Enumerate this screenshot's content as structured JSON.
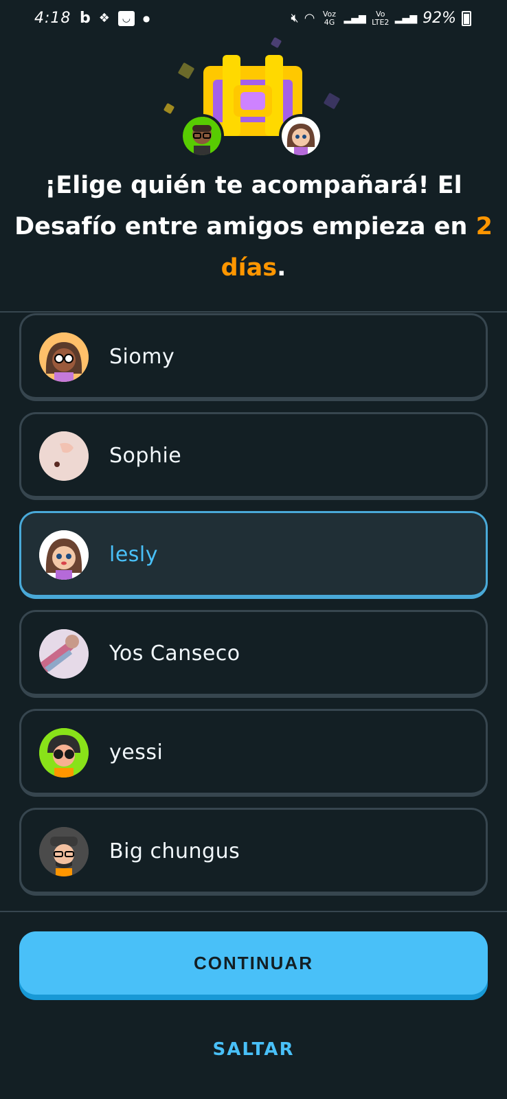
{
  "status_bar": {
    "time": "4:18",
    "battery": "92%",
    "network_labels": [
      "Voz 4G",
      "Vo LTE2"
    ]
  },
  "headline": {
    "text": "¡Elige quién te acompañará! El Desafío entre amigos empieza en ",
    "accent": "2 días",
    "suffix": "."
  },
  "friends": [
    {
      "name": "Siomy",
      "selected": false
    },
    {
      "name": "Sophie",
      "selected": false
    },
    {
      "name": "lesly",
      "selected": true
    },
    {
      "name": "Yos Canseco",
      "selected": false
    },
    {
      "name": "yessi",
      "selected": false
    },
    {
      "name": "Big chungus",
      "selected": false
    }
  ],
  "buttons": {
    "continue": "CONTINUAR",
    "skip": "SALTAR"
  },
  "colors": {
    "background": "#131f24",
    "accent_orange": "#ff9600",
    "accent_blue": "#49c0f8",
    "border": "#37464f",
    "selected_border": "#49a9d8"
  }
}
